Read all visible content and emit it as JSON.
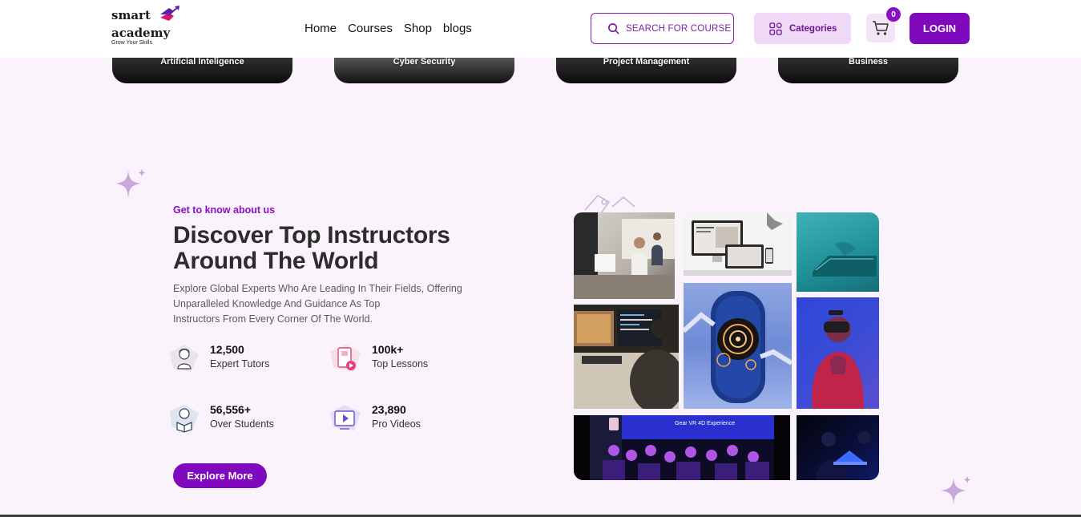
{
  "brand": {
    "line1": "smart",
    "line2": "academy",
    "tagline": "Grow Your Skills"
  },
  "nav": {
    "items": [
      "Home",
      "Courses",
      "Shop",
      "blogs"
    ]
  },
  "header": {
    "search_label": "SEARCH FOR COURSE",
    "categories_label": "Categories",
    "cart_count": "0",
    "login_label": "LOGIN"
  },
  "courses": [
    "Artificial Inteligence",
    "Cyber Security",
    "Project Management",
    "Business"
  ],
  "about": {
    "eyebrow": "Get to know about us",
    "headline_line1": "Discover Top Instructors",
    "headline_line2": "Around The World",
    "desc_line1": "Explore Global Experts Who Are Leading In Their Fields, Offering",
    "desc_line2": "Unparalleled Knowledge And Guidance As Top",
    "desc_line3": "Instructors From Every Corner Of The World.",
    "stats": [
      {
        "value": "12,500",
        "label": "Expert Tutors"
      },
      {
        "value": "100k+",
        "label": "Top Lessons"
      },
      {
        "value": "56,556+",
        "label": "Over Students"
      },
      {
        "value": "23,890",
        "label": "Pro Videos"
      }
    ],
    "cta": "Explore More"
  },
  "collage": {
    "vr_banner": "Gear VR 4D Experience"
  },
  "colors": {
    "accent": "#8009bd",
    "accent_light": "#efd9f6",
    "bg": "#fbf3fc"
  }
}
